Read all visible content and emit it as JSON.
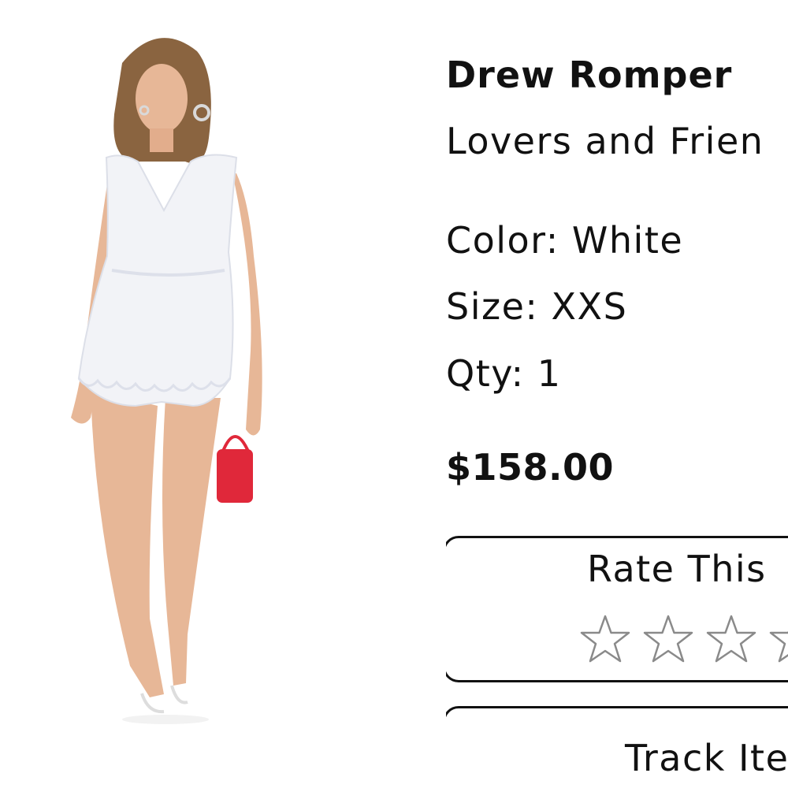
{
  "product": {
    "name": "Drew Romper",
    "brand": "Lovers and Frien",
    "color_line": "Color: White",
    "size_line": "Size: XXS",
    "qty_line": "Qty: 1",
    "price": "$158.00",
    "image_icon": "product-photo-icon"
  },
  "rating": {
    "title": "Rate This",
    "max_stars": 5,
    "selected_stars": 0,
    "star_icon": "star-outline-icon"
  },
  "track": {
    "label": "Track Ite"
  },
  "colors": {
    "text": "#111111",
    "border": "#111111",
    "star_stroke": "#8a8a8a",
    "bag": "#e0283a"
  }
}
